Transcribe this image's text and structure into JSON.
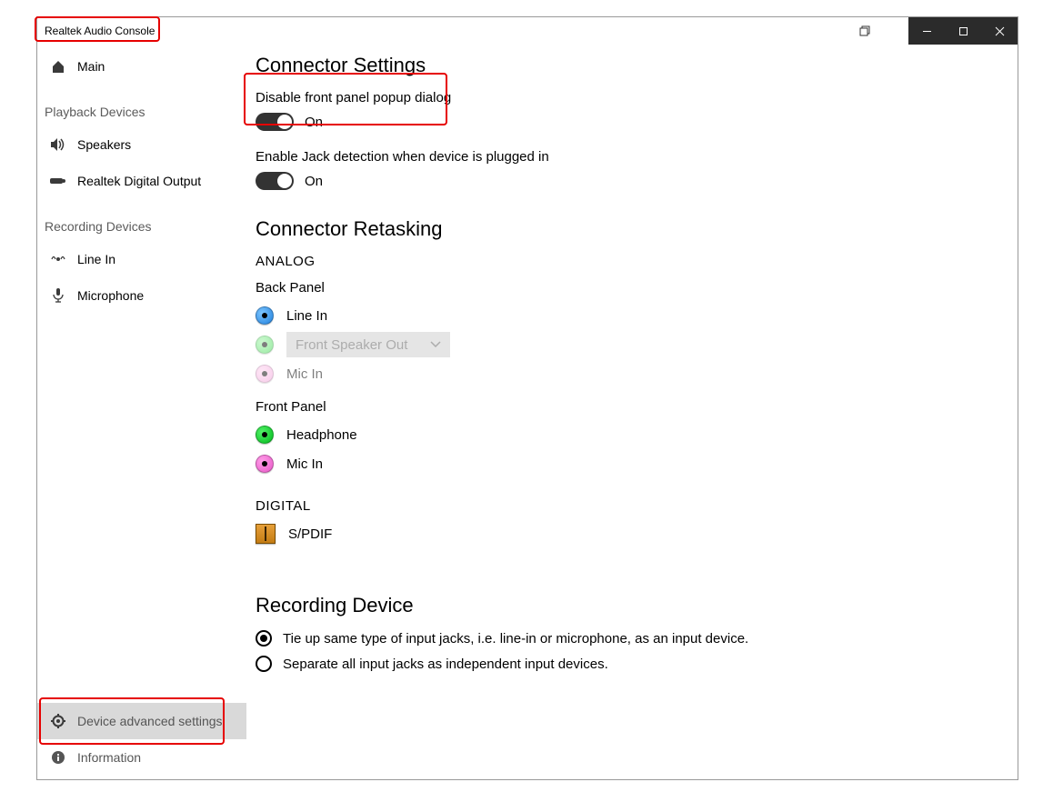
{
  "window": {
    "title": "Realtek Audio Console"
  },
  "titlebar_icons": {
    "overlap": "overlap-windows-icon",
    "min": "minimize-icon",
    "max": "maximize-icon",
    "close": "close-icon"
  },
  "sidebar": {
    "main": "Main",
    "playback_header": "Playback Devices",
    "playback": [
      {
        "label": "Speakers",
        "icon": "speaker-icon"
      },
      {
        "label": "Realtek Digital Output",
        "icon": "digital-out-icon"
      }
    ],
    "recording_header": "Recording Devices",
    "recording": [
      {
        "label": "Line In",
        "icon": "line-in-icon"
      },
      {
        "label": "Microphone",
        "icon": "microphone-icon"
      }
    ],
    "device_advanced": "Device advanced settings",
    "information": "Information"
  },
  "connector_settings": {
    "title": "Connector Settings",
    "disable_front_panel": {
      "label": "Disable front panel popup dialog",
      "state": "On"
    },
    "enable_jack_detection": {
      "label": "Enable Jack detection when device is plugged in",
      "state": "On"
    }
  },
  "connector_retasking": {
    "title": "Connector Retasking",
    "analog_label": "ANALOG",
    "back_panel_label": "Back Panel",
    "back_panel": {
      "line_in": {
        "label": "Line In",
        "color": "#1e7fdc"
      },
      "front_speaker_out": {
        "label": "Front Speaker Out",
        "color": "#39d84a"
      },
      "mic_in": {
        "label": "Mic In",
        "color": "#f09ad6"
      }
    },
    "front_panel_label": "Front Panel",
    "front_panel": {
      "headphone": {
        "label": "Headphone",
        "color": "#00b81a"
      },
      "mic_in": {
        "label": "Mic In",
        "color": "#e855c6"
      }
    },
    "digital_label": "DIGITAL",
    "spdif": "S/PDIF"
  },
  "recording_device": {
    "title": "Recording Device",
    "option_tie": "Tie up same type of input jacks, i.e. line-in or microphone, as an input device.",
    "option_separate": "Separate all input jacks as independent input devices."
  }
}
